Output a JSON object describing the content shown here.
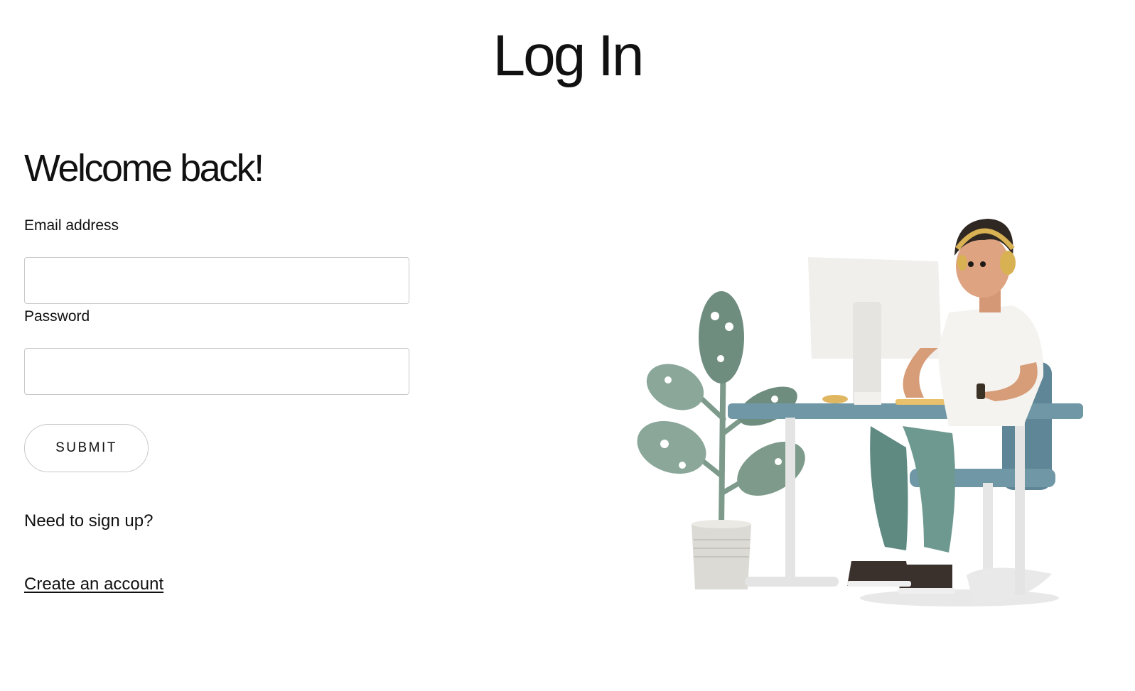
{
  "page": {
    "title": "Log In"
  },
  "form": {
    "heading": "Welcome back!",
    "email_label": "Email address",
    "email_value": "",
    "password_label": "Password",
    "password_value": "",
    "submit_label": "SUBMIT"
  },
  "signup": {
    "prompt": "Need to sign up?",
    "link_label": "Create an account"
  },
  "illustration": {
    "icon": "person-at-desk-illustration"
  },
  "colors": {
    "text": "#111111",
    "border": "#c8c8c8",
    "desk": "#6f97a6",
    "plant": "#6f8d7f",
    "pants": "#5f8a82"
  }
}
